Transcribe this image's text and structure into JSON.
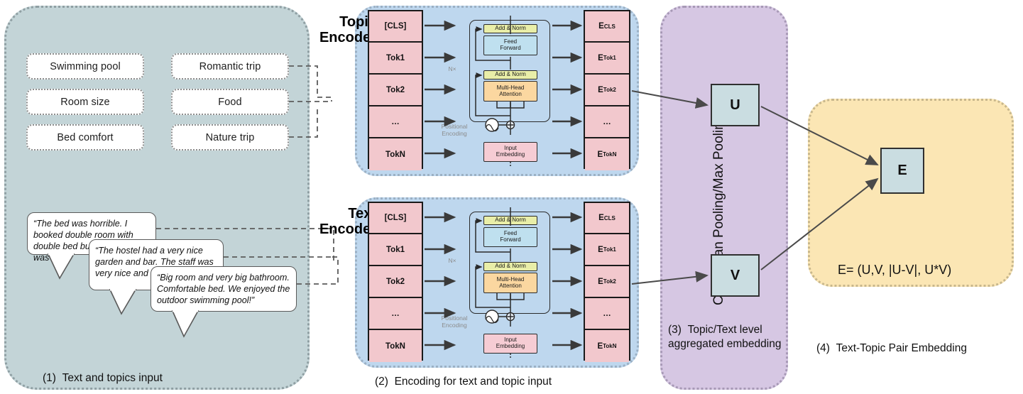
{
  "panels": {
    "input": {
      "caption_num": "(1)",
      "caption": "Text and topics input",
      "fill": "#c3d4d7"
    },
    "encoding": {
      "caption_num": "(2)",
      "caption": "Encoding for text and topic input",
      "fill": "#bed7ee"
    },
    "pooling": {
      "caption_num": "(3)",
      "caption": "Topic/Text level aggregated embedding",
      "vertical_label": "CLS/Mean Pooling/Max Pooling",
      "fill": "#d6c7e3"
    },
    "pair": {
      "caption_num": "(4)",
      "caption": "Text-Topic Pair Embedding",
      "formula": "E= (U,V, |U-V|, U*V)",
      "fill": "#fbe6b4"
    }
  },
  "topics": {
    "left_column": [
      "Swimming pool",
      "Room size",
      "Bed comfort"
    ],
    "right_column": [
      "Romantic trip",
      "Food",
      "Nature trip"
    ]
  },
  "reviews": [
    "“The bed was horrible. I booked double room with double bed but actually it was ",
    "“The hostel had a very nice garden and bar. The staff was very nice and location was g",
    "“Big room and very big bathroom. Comfortable bed. We enjoyed the outdoor swimming pool!”"
  ],
  "encoders": [
    {
      "name": "Topic Encoder",
      "title_line1": "Topic",
      "title_line2": "Encoder",
      "input_tokens": [
        "[CLS]",
        "Tok1",
        "Tok2",
        "…",
        "TokN"
      ],
      "output_tokens": [
        {
          "base": "E",
          "sub": "CLS"
        },
        {
          "base": "E",
          "sub": "Tok1"
        },
        {
          "base": "E",
          "sub": "Tok2"
        },
        {
          "base": "…",
          "sub": ""
        },
        {
          "base": "E",
          "sub": "TokN"
        }
      ]
    },
    {
      "name": "Text Encoder",
      "title_line1": "Text",
      "title_line2": "Encoder",
      "input_tokens": [
        "[CLS]",
        "Tok1",
        "Tok2",
        "…",
        "TokN"
      ],
      "output_tokens": [
        {
          "base": "E",
          "sub": "CLS"
        },
        {
          "base": "E",
          "sub": "Tok1"
        },
        {
          "base": "E",
          "sub": "Tok2"
        },
        {
          "base": "…",
          "sub": ""
        },
        {
          "base": "E",
          "sub": "TokN"
        }
      ]
    }
  ],
  "transformer": {
    "add_norm_top": "Add & Norm",
    "feed_forward": "Feed\nForward",
    "feed_forward_l1": "Feed",
    "feed_forward_l2": "Forward",
    "add_norm_bottom": "Add & Norm",
    "multi_head_l1": "Multi-Head",
    "multi_head_l2": "Attention",
    "repeat": "N×",
    "positional_l1": "Positional",
    "positional_l2": "Encoding",
    "input_embedding_l1": "Input",
    "input_embedding_l2": "Embedding",
    "colors": {
      "add_norm": "#e9eea8",
      "feed_forward": "#bfe0ef",
      "multi_head": "#fbd7a0",
      "input_embedding": "#f6ccd4",
      "token": "#f2c8cd"
    }
  },
  "pooled": {
    "u_label": "U",
    "v_label": "V",
    "e_label": "E",
    "box_fill": "#cadde1"
  }
}
